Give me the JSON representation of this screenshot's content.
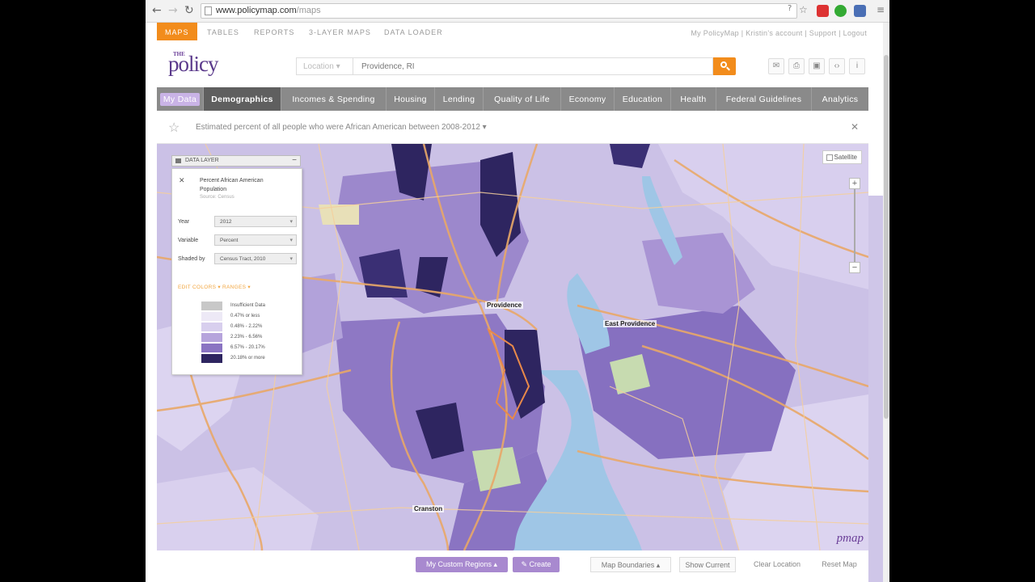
{
  "browser": {
    "url_host": "www.policymap.com",
    "url_path": "/maps"
  },
  "topnav": {
    "items": [
      "MAPS",
      "TABLES",
      "REPORTS",
      "3-LAYER MAPS",
      "DATA LOADER"
    ],
    "user_links": "My PolicyMap  |  Kristin's account  |  Support  |  Logout"
  },
  "logo": {
    "the": "THE",
    "policy": "policy",
    "map": "map"
  },
  "search": {
    "location_label": "Location",
    "query": "Providence, RI"
  },
  "categories": [
    "My Data",
    "Demographics",
    "Incomes & Spending",
    "Housing",
    "Lending",
    "Quality of Life",
    "Economy",
    "Education",
    "Health",
    "Federal Guidelines",
    "Analytics"
  ],
  "description": "Estimated percent of all people who were African American between 2008-2012",
  "data_layer": {
    "header": "DATA LAYER",
    "title": "Percent African American Population",
    "source": "Source: Census",
    "year_label": "Year",
    "year_value": "2012",
    "variable_label": "Variable",
    "variable_value": "Percent",
    "shaded_label": "Shaded by",
    "shaded_value": "Census Tract, 2010",
    "links": "EDIT    COLORS ▾    RANGES ▾",
    "legend": [
      {
        "label": "Insufficient Data",
        "color": "#c8c8c8"
      },
      {
        "label": "0.47% or less",
        "color": "#ede9f6"
      },
      {
        "label": "0.48% - 2.22%",
        "color": "#d8cfee"
      },
      {
        "label": "2.23% - 6.56%",
        "color": "#b6a4dc"
      },
      {
        "label": "6.57% - 20.17%",
        "color": "#8a74c2"
      },
      {
        "label": "20.18% or more",
        "color": "#2e2560"
      }
    ]
  },
  "map": {
    "satellite": "Satellite",
    "labels": [
      "Providence",
      "East Providence",
      "Cranston"
    ],
    "brand": "pmap"
  },
  "bottom": {
    "regions": "My Custom Regions ▴",
    "create": "Create",
    "boundaries": "Map Boundaries ▴",
    "show_current": "Show Current",
    "clear_location": "Clear Location",
    "reset_map": "Reset Map"
  },
  "colors": {
    "accent": "#f28c1c",
    "brand": "#5b3a8c"
  }
}
